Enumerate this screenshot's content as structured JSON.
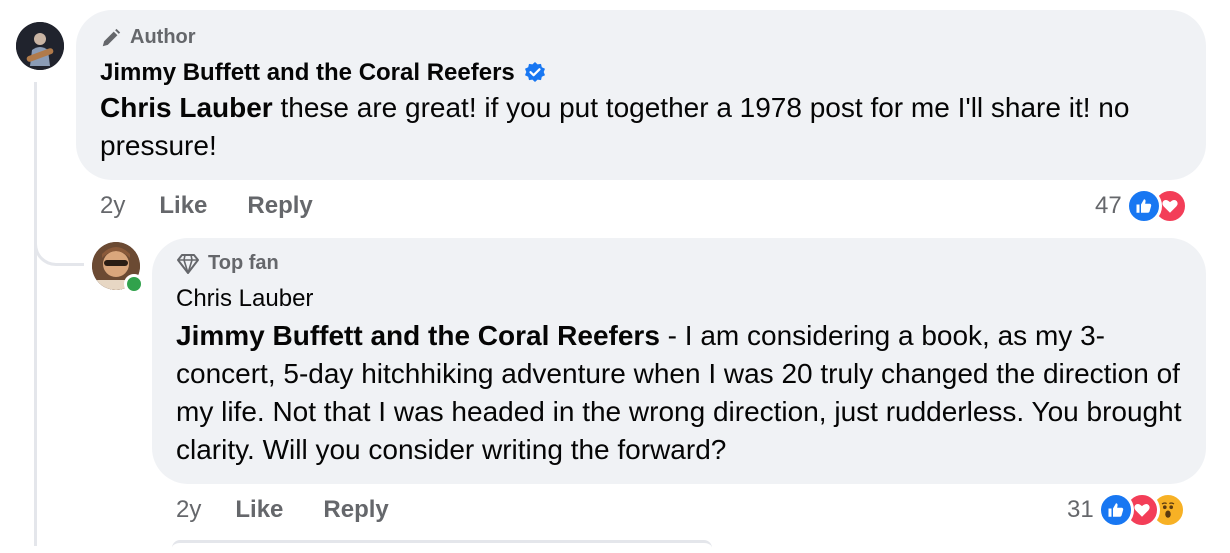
{
  "comments": [
    {
      "badge": "Author",
      "badge_icon": "pencil-icon",
      "author": "Jimmy Buffett and the Coral Reefers",
      "verified": true,
      "mention": "Chris Lauber",
      "text": " these are great! if you put together a 1978 post for me I'll share it! no pressure!",
      "time": "2y",
      "like_label": "Like",
      "reply_label": "Reply",
      "reaction_count": "47",
      "reactions": [
        "like",
        "love"
      ]
    },
    {
      "badge": "Top fan",
      "badge_icon": "diamond-icon",
      "author": "Chris Lauber",
      "verified": false,
      "mention": "Jimmy Buffett and the Coral Reefers",
      "text": " - I am considering a book, as my 3-concert, 5-day hitchhiking adventure when I was 20 truly changed the direction of my life. Not that I was headed in the wrong direction, just rudderless. You brought clarity. Will you consider writing the forward?",
      "time": "2y",
      "like_label": "Like",
      "reply_label": "Reply",
      "reaction_count": "31",
      "reactions": [
        "like",
        "love",
        "wow"
      ],
      "online": true
    }
  ],
  "colors": {
    "bubble": "#f0f2f5",
    "secondary_text": "#65676b",
    "verified": "#1877f2",
    "like": "#1877f2",
    "love": "#f33e58",
    "wow": "#f7b125",
    "online": "#31a24c"
  }
}
